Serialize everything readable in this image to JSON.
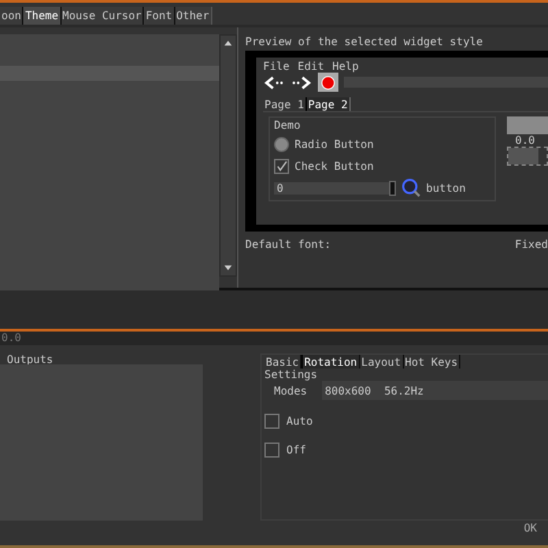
{
  "top_tabs": [
    {
      "label": "oon",
      "selected": false
    },
    {
      "label": "Theme",
      "selected": true
    },
    {
      "label": "Mouse Cursor",
      "selected": false
    },
    {
      "label": "Font",
      "selected": false
    },
    {
      "label": "Other",
      "selected": false
    }
  ],
  "theme_list": {
    "items": [
      {
        "selected": true
      }
    ]
  },
  "preview": {
    "caption": "Preview of the selected widget style",
    "menu": [
      "File",
      "Edit",
      "Help"
    ],
    "tabs": [
      {
        "label": "Page 1",
        "selected": false
      },
      {
        "label": "Page 2",
        "selected": true
      }
    ],
    "group_title": "Demo",
    "radio": {
      "label": "Radio Button",
      "checked": false
    },
    "check": {
      "label": "Check Button",
      "checked": true
    },
    "spin_value": "0",
    "icon_button_label": "button",
    "progress": {
      "level": 1.0,
      "reading": "0.0"
    }
  },
  "default_font_label": "Default font:",
  "fixed_font_label": "Fixed",
  "version": "0.0",
  "outputs_label": "Outputs",
  "settings_tabs": [
    {
      "label": "Basic",
      "selected": false
    },
    {
      "label": "Rotation",
      "selected": true
    },
    {
      "label": "Layout",
      "selected": false
    },
    {
      "label": "Hot Keys",
      "selected": false
    }
  ],
  "settings_title": "Settings",
  "modes": {
    "label": "Modes",
    "value": "800x600  56.2Hz"
  },
  "options": [
    {
      "label": "Auto",
      "checked": false
    },
    {
      "label": "Off",
      "checked": false
    }
  ],
  "ok_button": "OK"
}
